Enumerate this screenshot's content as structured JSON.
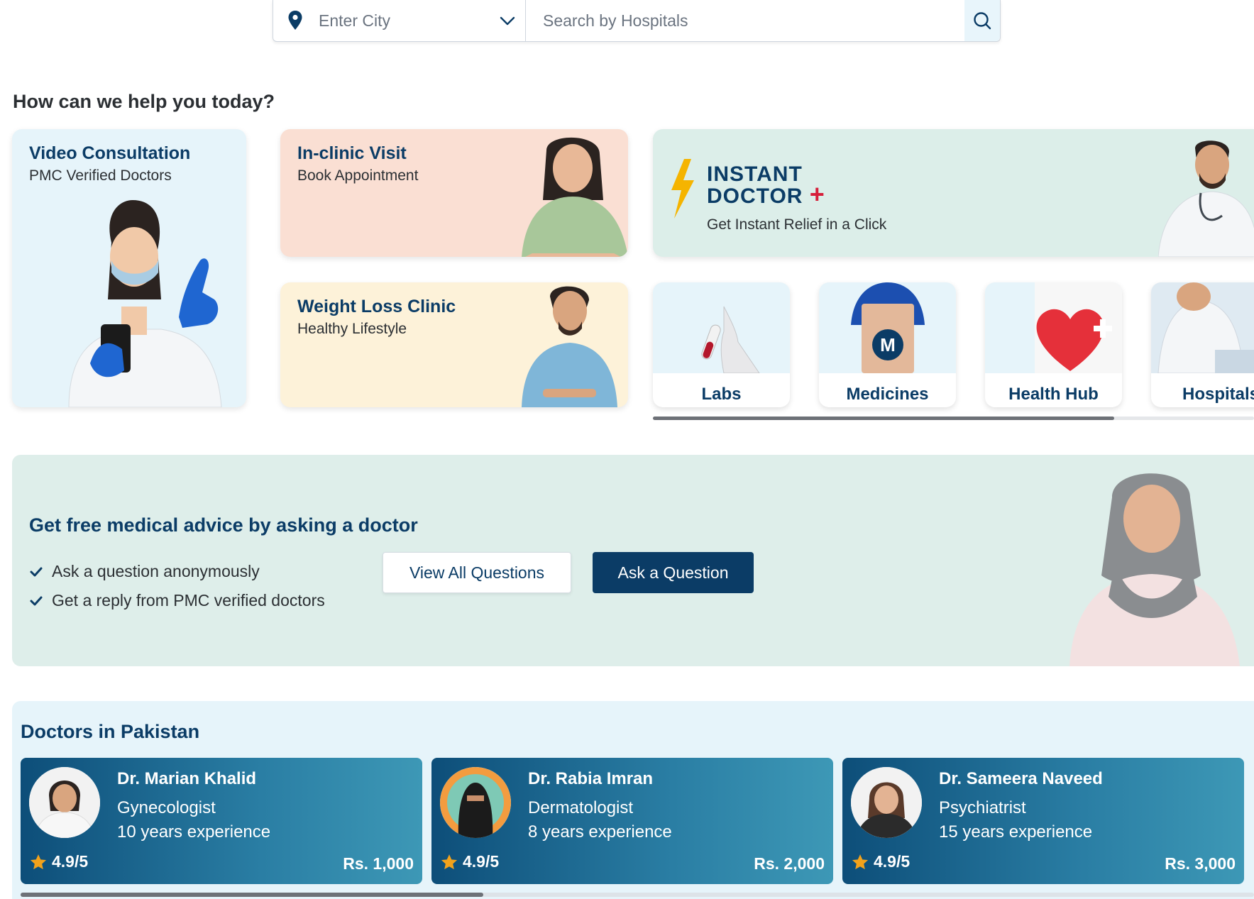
{
  "search": {
    "city_placeholder": "Enter City",
    "query_placeholder": "Search by Hospitals"
  },
  "help": {
    "title": "How can we help you today?"
  },
  "services": {
    "video": {
      "title": "Video Consultation",
      "subtitle": "PMC Verified Doctors"
    },
    "clinic": {
      "title": "In-clinic Visit",
      "subtitle": "Book Appointment"
    },
    "weight": {
      "title": "Weight Loss Clinic",
      "subtitle": "Healthy Lifestyle"
    },
    "instant": {
      "title_line1": "INSTANT",
      "title_line2": "DOCTOR",
      "plus": "+",
      "subtitle": "Get Instant Relief in a Click"
    },
    "tiles": [
      {
        "label": "Labs",
        "icon": "test-tube-icon"
      },
      {
        "label": "Medicines",
        "icon": "medicine-box-icon"
      },
      {
        "label": "Health Hub",
        "icon": "heart-icon"
      },
      {
        "label": "Hospitals",
        "icon": "hospital-icon"
      }
    ]
  },
  "advice": {
    "title": "Get free medical advice by asking a doctor",
    "points": [
      "Ask a question anonymously",
      "Get a reply from PMC verified doctors"
    ],
    "view_button": "View All Questions",
    "ask_button": "Ask a Question"
  },
  "doctors": {
    "title": "Doctors in Pakistan",
    "list": [
      {
        "name": "Dr. Marian Khalid",
        "specialty": "Gynecologist",
        "experience": "10 years experience",
        "rating": "4.9/5",
        "fee": "Rs. 1,000"
      },
      {
        "name": "Dr. Rabia Imran",
        "specialty": "Dermatologist",
        "experience": "8 years experience",
        "rating": "4.9/5",
        "fee": "Rs. 2,000"
      },
      {
        "name": "Dr. Sameera Naveed",
        "specialty": "Psychiatrist",
        "experience": "15 years experience",
        "rating": "4.9/5",
        "fee": "Rs. 3,000"
      }
    ]
  },
  "colors": {
    "brand_navy": "#0b3c66",
    "accent_red": "#d61f3a",
    "star": "#f3a21b",
    "bolt": "#f5b400"
  }
}
